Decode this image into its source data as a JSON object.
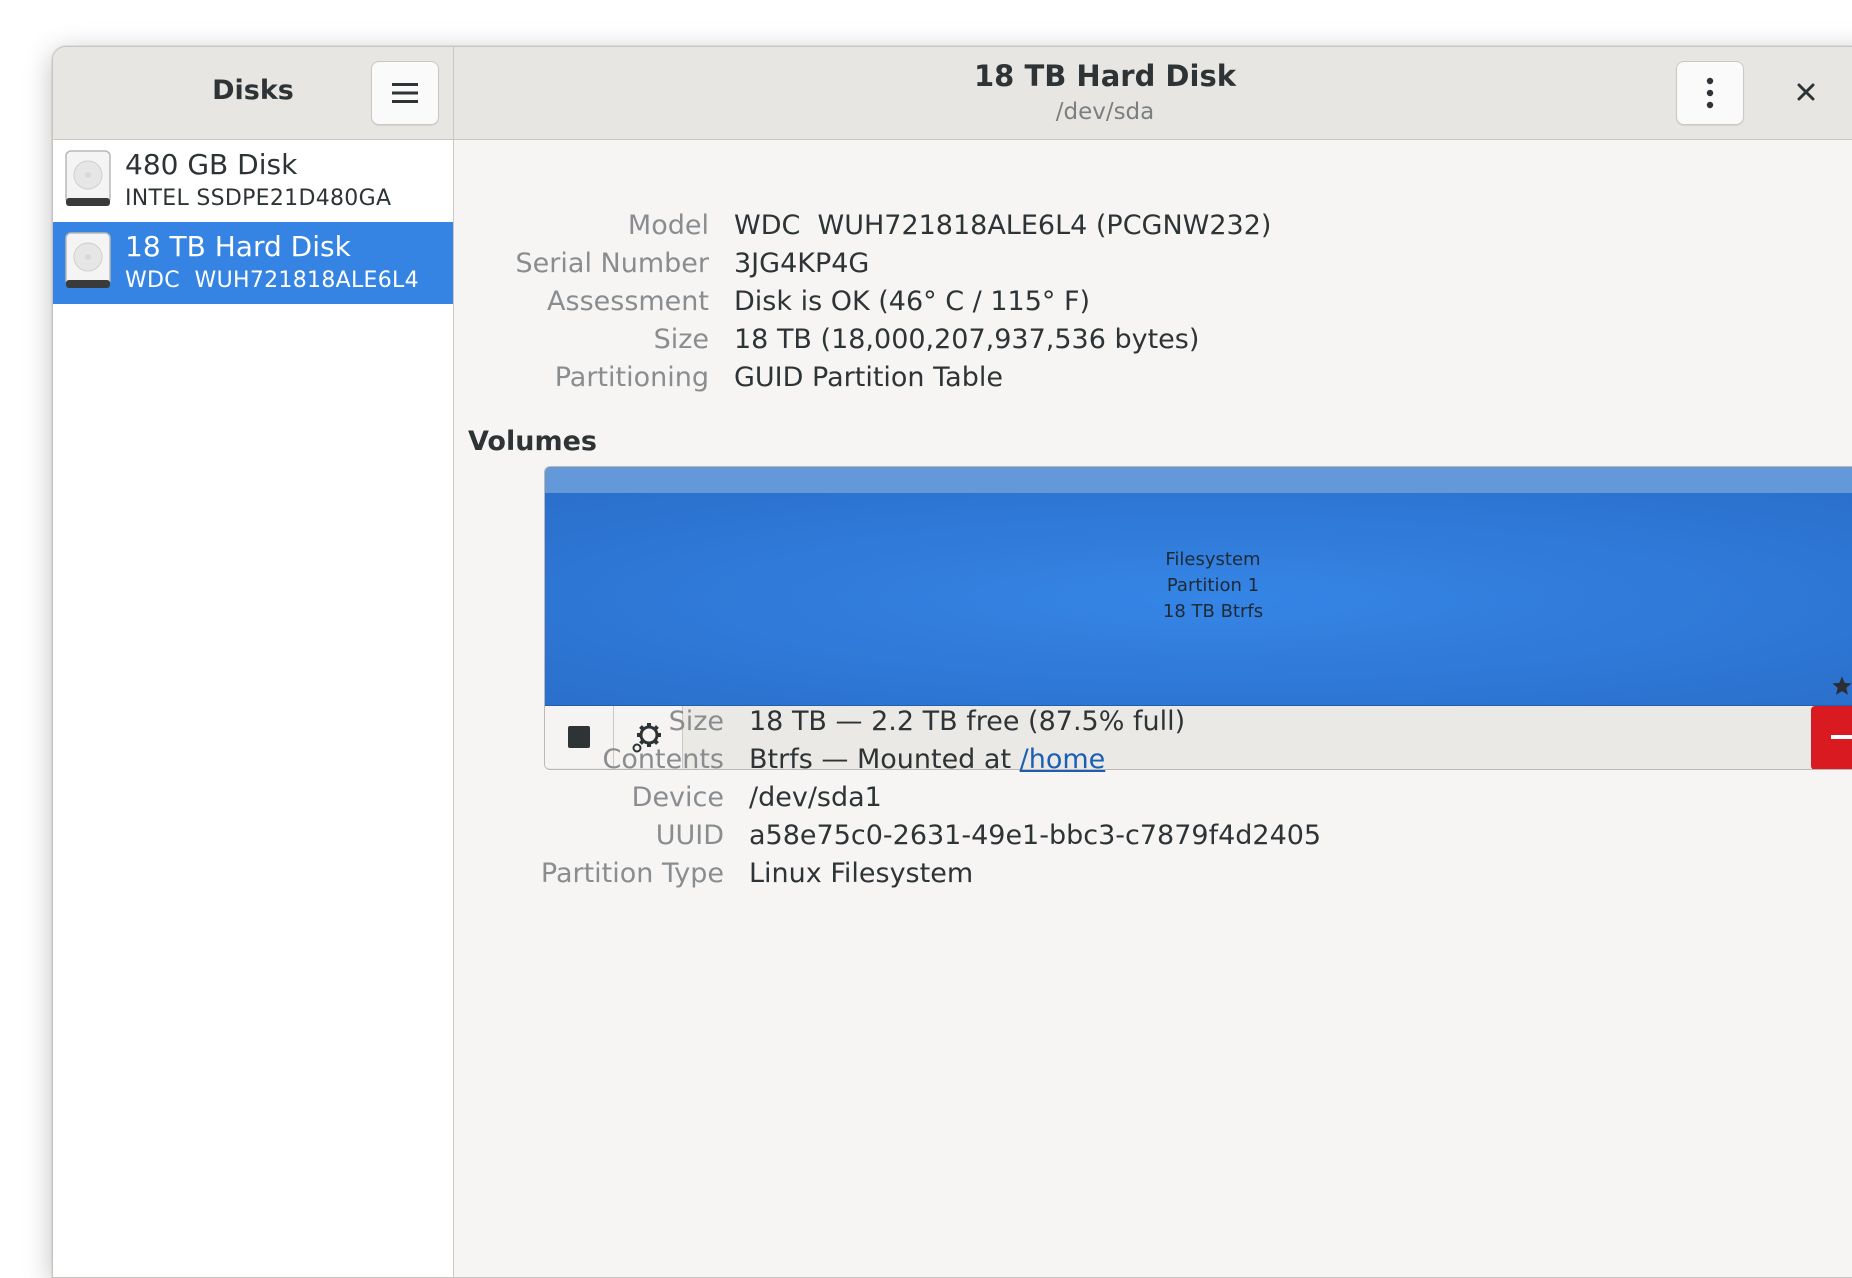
{
  "app": {
    "title": "Disks"
  },
  "header": {
    "title": "18 TB Hard Disk",
    "subtitle": "/dev/sda"
  },
  "sidebar": {
    "disks": [
      {
        "name": "480 GB Disk",
        "model": "INTEL SSDPE21D480GA",
        "selected": false
      },
      {
        "name": "18 TB Hard Disk",
        "model": "WDC  WUH721818ALE6L4",
        "selected": true
      }
    ]
  },
  "disk_info": {
    "model_label": "Model",
    "model": "WDC  WUH721818ALE6L4 (PCGNW232)",
    "serial_label": "Serial Number",
    "serial": "3JG4KP4G",
    "assessment_label": "Assessment",
    "assessment": "Disk is OK (46° C / 115° F)",
    "size_label": "Size",
    "size": "18 TB (18,000,207,937,536 bytes)",
    "partitioning_label": "Partitioning",
    "partitioning": "GUID Partition Table"
  },
  "volumes": {
    "heading": "Volumes",
    "partition": {
      "line1": "Filesystem",
      "line2": "Partition 1",
      "line3": "18 TB Btrfs"
    }
  },
  "partition_info": {
    "size_label": "Size",
    "size": "18 TB — 2.2 TB free (87.5% full)",
    "contents_label": "Contents",
    "contents_prefix": "Btrfs — Mounted at ",
    "mount_link": "/home",
    "device_label": "Device",
    "device": "/dev/sda1",
    "uuid_label": "UUID",
    "uuid": "a58e75c0-2631-49e1-bbc3-c7879f4d2405",
    "type_label": "Partition Type",
    "type": "Linux Filesystem"
  },
  "colors": {
    "accent": "#3584e4",
    "partition": "#2f7fe0",
    "danger": "#d91b21",
    "link": "#1a5fb4"
  },
  "icons": [
    "menu-icon",
    "kebab-icon",
    "close-icon",
    "hard-disk-icon",
    "stop-icon",
    "gear-icon",
    "star-icon",
    "play-icon",
    "minus-icon"
  ]
}
